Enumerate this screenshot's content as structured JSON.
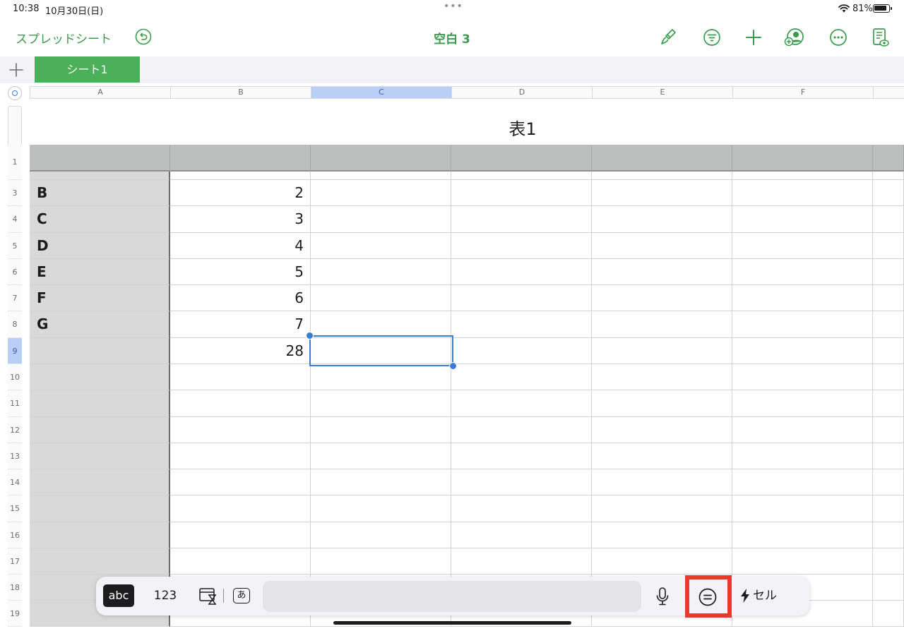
{
  "status_bar": {
    "time": "10:38",
    "date": "10月30日(日)",
    "battery": "81%"
  },
  "toolbar": {
    "back_label": "スプレッドシート",
    "document_title": "空白 3"
  },
  "sheets": {
    "active": "シート1"
  },
  "columns": [
    "A",
    "B",
    "C",
    "D",
    "E",
    "F"
  ],
  "selected_column": "C",
  "rows": [
    "1",
    "3",
    "4",
    "5",
    "6",
    "7",
    "8",
    "9",
    "10",
    "11",
    "12",
    "13",
    "14",
    "15",
    "16",
    "17",
    "18",
    "19"
  ],
  "selected_row": "9",
  "table": {
    "title": "表1",
    "data_rows": [
      {
        "category": "B",
        "value": "2"
      },
      {
        "category": "C",
        "value": "3"
      },
      {
        "category": "D",
        "value": "4"
      },
      {
        "category": "E",
        "value": "5"
      },
      {
        "category": "F",
        "value": "6"
      },
      {
        "category": "G",
        "value": "7"
      }
    ],
    "total": "28"
  },
  "keyboard_bar": {
    "mode_text_label": "abc",
    "mode_number_label": "123",
    "text_mode_glyph": "あ",
    "formula_value": "",
    "cell_action_label": "セル"
  },
  "colors": {
    "accent": "#3a9b4e",
    "selection": "#3a7bd5",
    "highlight": "#e8392b"
  }
}
